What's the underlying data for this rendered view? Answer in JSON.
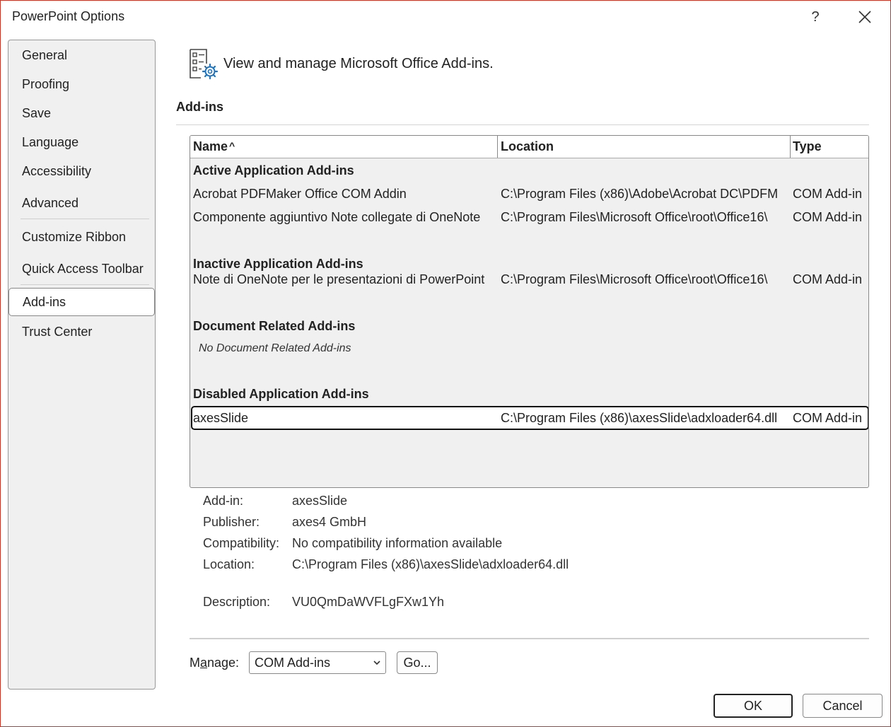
{
  "window": {
    "title": "PowerPoint Options",
    "help_label": "?"
  },
  "sidebar": {
    "items": [
      {
        "label": "General"
      },
      {
        "label": "Proofing"
      },
      {
        "label": "Save"
      },
      {
        "label": "Language"
      },
      {
        "label": "Accessibility"
      },
      {
        "label": "Advanced"
      },
      {
        "label": "Customize Ribbon"
      },
      {
        "label": "Quick Access Toolbar"
      },
      {
        "label": "Add-ins"
      },
      {
        "label": "Trust Center"
      }
    ],
    "selected": "Add-ins"
  },
  "header": {
    "text": "View and manage Microsoft Office Add-ins.",
    "icon": "addins-settings-icon"
  },
  "section": {
    "title": "Add-ins"
  },
  "table": {
    "columns": {
      "name": "Name",
      "sort_indicator": "^",
      "location": "Location",
      "type": "Type"
    },
    "groups": {
      "active": "Active Application Add-ins",
      "inactive": "Inactive Application Add-ins",
      "document": "Document Related Add-ins",
      "disabled": "Disabled Application Add-ins"
    },
    "document_empty": "No Document Related Add-ins",
    "rows": {
      "active_1": {
        "name": "Acrobat PDFMaker Office COM Addin",
        "location": "C:\\Program Files (x86)\\Adobe\\Acrobat DC\\PDFM",
        "type": "COM Add-in"
      },
      "active_2": {
        "name": "Componente aggiuntivo Note collegate di OneNote",
        "location": "C:\\Program Files\\Microsoft Office\\root\\Office16\\",
        "type": "COM Add-in"
      },
      "inactive_1": {
        "name": "Note di OneNote per le presentazioni di PowerPoint",
        "location": "C:\\Program Files\\Microsoft Office\\root\\Office16\\",
        "type": "COM Add-in"
      },
      "disabled_1": {
        "name": "axesSlide",
        "location": "C:\\Program Files (x86)\\axesSlide\\adxloader64.dll",
        "type": "COM Add-in"
      }
    }
  },
  "details": {
    "addin": {
      "label": "Add-in:",
      "value": "axesSlide"
    },
    "publisher": {
      "label": "Publisher:",
      "value": "axes4 GmbH"
    },
    "compatibility": {
      "label": "Compatibility:",
      "value": "No compatibility information available"
    },
    "location": {
      "label": "Location:",
      "value": "C:\\Program Files (x86)\\axesSlide\\adxloader64.dll"
    },
    "description": {
      "label": "Description:",
      "value": "VU0QmDaWVFLgFXw1Yh"
    }
  },
  "manage": {
    "label_prefix": "M",
    "label_accel": "a",
    "label_suffix": "nage:",
    "selected": "COM Add-ins",
    "go_label": "Go..."
  },
  "footer": {
    "ok_label": "OK",
    "cancel_label": "Cancel"
  }
}
